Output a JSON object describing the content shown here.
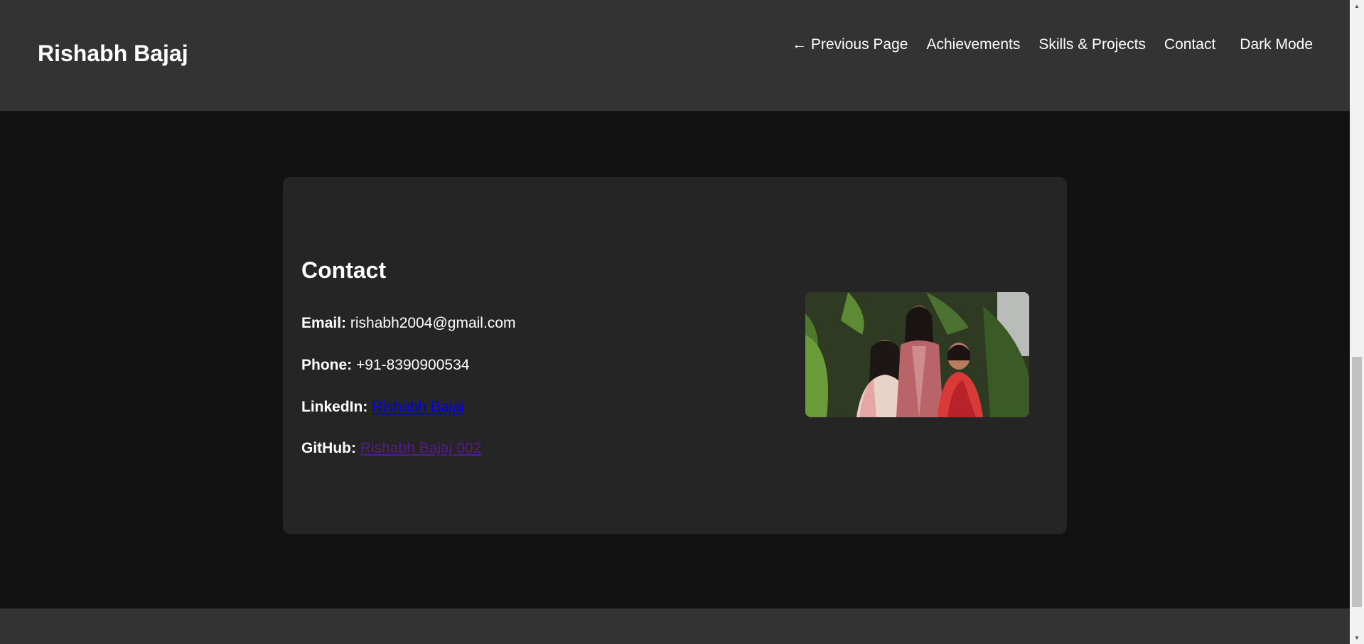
{
  "header": {
    "title": "Rishabh Bajaj",
    "nav": {
      "previous": "← Previous Page",
      "achievements": "Achievements",
      "skills": "Skills & Projects",
      "contact": "Contact",
      "dark_mode": "Dark Mode"
    }
  },
  "contact": {
    "heading": "Contact",
    "email_label": "Email:",
    "email_value": "rishabh2004@gmail.com",
    "phone_label": "Phone:",
    "phone_value": "+91-8390900534",
    "linkedin_label": "LinkedIn:",
    "linkedin_text": "Rishabh Bajaj",
    "github_label": "GitHub:",
    "github_text": "Rishabh Bajaj 002"
  },
  "colors": {
    "page_bg": "#121212",
    "header_bg": "#333333",
    "card_bg": "#252525",
    "link_unvisited": "#0000ee",
    "link_visited": "#551a8b"
  }
}
